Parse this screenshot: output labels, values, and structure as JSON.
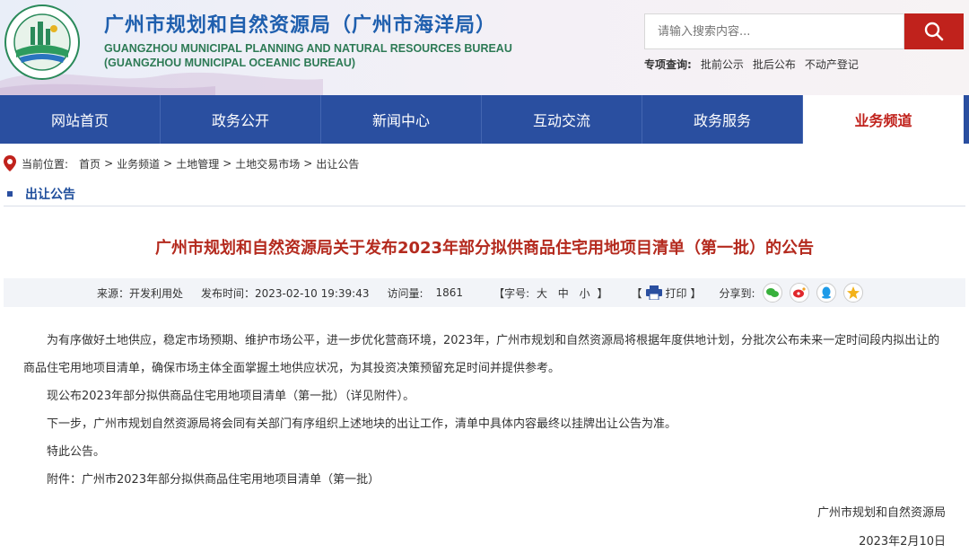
{
  "header": {
    "title_cn": "广州市规划和自然资源局（广州市海洋局）",
    "title_en_1": "GUANGZHOU MUNICIPAL PLANNING AND NATURAL RESOURCES BUREAU",
    "title_en_2": "(GUANGZHOU MUNICIPAL OCEANIC BUREAU)",
    "search_placeholder": "请输入搜索内容...",
    "special_label": "专项查询:",
    "special_links": [
      "批前公示",
      "批后公布",
      "不动产登记"
    ]
  },
  "nav": {
    "items": [
      "网站首页",
      "政务公开",
      "新闻中心",
      "互动交流",
      "政务服务",
      "业务频道"
    ],
    "active_index": 5
  },
  "breadcrumb": {
    "label": "当前位置:",
    "items": [
      "首页",
      "业务频道",
      "土地管理",
      "土地交易市场",
      "出让公告"
    ],
    "separator": ">"
  },
  "section_title": "出让公告",
  "article": {
    "title": "广州市规划和自然资源局关于发布2023年部分拟供商品住宅用地项目清单（第一批）的公告",
    "source": "来源：开发利用处",
    "publish_time": "发布时间：2023-02-10 19:39:43",
    "views_label": "访问量:",
    "views": "1861",
    "font_label": "【字号:",
    "font_sizes": [
      "大",
      "中",
      "小"
    ],
    "font_close": "】",
    "print_open": "【",
    "print_label": "打印",
    "print_close": "】",
    "share_label": "分享到:",
    "share_icons": [
      "wechat-icon",
      "weibo-icon",
      "qq-icon",
      "qzone-icon"
    ],
    "paragraphs": [
      "为有序做好土地供应，稳定市场预期、维护市场公平，进一步优化营商环境，2023年，广州市规划和自然资源局将根据年度供地计划，分批次公布未来一定时间段内拟出让的商品住宅用地项目清单，确保市场主体全面掌握土地供应状况，为其投资决策预留充足时间并提供参考。",
      "现公布2023年部分拟供商品住宅用地项目清单（第一批）（详见附件）。",
      "下一步，广州市规划自然资源局将会同有关部门有序组织上述地块的出让工作，清单中具体内容最终以挂牌出让公告为准。",
      "特此公告。",
      "附件：广州市2023年部分拟供商品住宅用地项目清单（第一批）"
    ],
    "signature": "广州市规划和自然资源局",
    "date": "2023年2月10日"
  },
  "colors": {
    "nav_bg": "#2a4fa0",
    "accent_red": "#c0221c",
    "title_red": "#b42a1e",
    "title_blue": "#1f5fae"
  }
}
